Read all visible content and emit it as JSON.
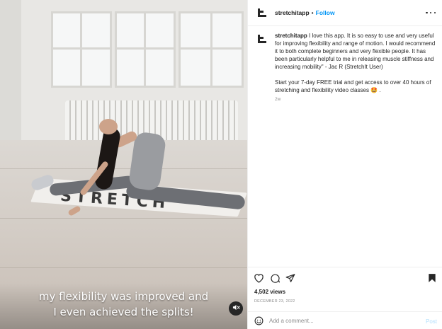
{
  "post": {
    "caption_overlay": [
      "my flexibility was improved and",
      "I even achieved the splits!"
    ],
    "mat_text": "STRETCH"
  },
  "header": {
    "username": "stretchitapp",
    "separator": "•",
    "follow_label": "Follow"
  },
  "comment": {
    "username": "stretchitapp",
    "text": "I love this app. It is so easy to use and very useful for improving flexibility and range of motion. I would recommend it to both complete beginners and very flexible people. It has been particularly helpful to me in releasing muscle stiffness and increasing mobility\" - Jac R (StretchIt User)",
    "text2": "Start your 7-day FREE trial and get access to over 40 hours of stretching and flexibility video classes 🤩 .",
    "time": "2w"
  },
  "stats": {
    "views": "4,502 views",
    "date": "DECEMBER 23, 2022"
  },
  "compose": {
    "placeholder": "Add a comment...",
    "post_label": "Post"
  },
  "icons": {
    "like": "heart-icon",
    "comment": "comment-icon",
    "share": "share-icon",
    "save": "bookmark-icon",
    "more": "more-icon",
    "mute": "muted-speaker-icon",
    "emoji": "emoji-icon"
  },
  "colors": {
    "accent": "#0095f6",
    "text": "#262626",
    "muted": "#8e8e8e"
  }
}
